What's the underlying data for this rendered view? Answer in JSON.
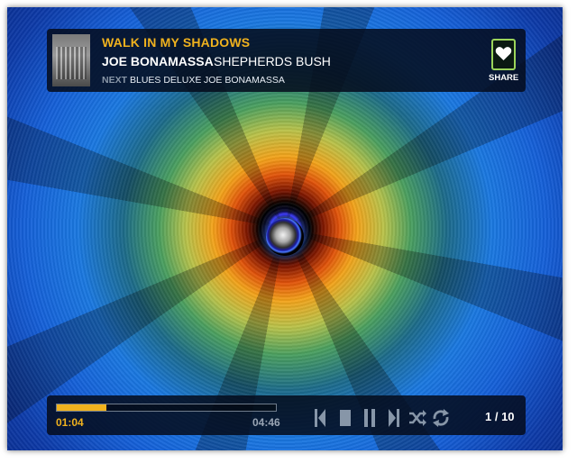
{
  "now_playing": {
    "title": "WALK IN MY SHADOWS",
    "artist": "JOE BONAMASSA",
    "album": "SHEPHERDS BUSH"
  },
  "up_next": {
    "label": "NEXT",
    "track": "BLUES DELUXE",
    "separator": "/",
    "artist": "JOE BONAMASSA"
  },
  "share": {
    "label": "SHARE",
    "icon": "heart-icon"
  },
  "playback": {
    "elapsed": "01:04",
    "total": "04:46",
    "progress_fraction": 0.226,
    "track_position": "1 / 10"
  },
  "controls": {
    "icons": [
      "skip-previous-icon",
      "stop-icon",
      "pause-icon",
      "skip-next-icon",
      "shuffle-icon",
      "repeat-icon"
    ]
  },
  "colors": {
    "accent": "#f0b21e",
    "share_border": "#9bd45a",
    "panel": "#050c1c",
    "control": "#8796a8"
  }
}
